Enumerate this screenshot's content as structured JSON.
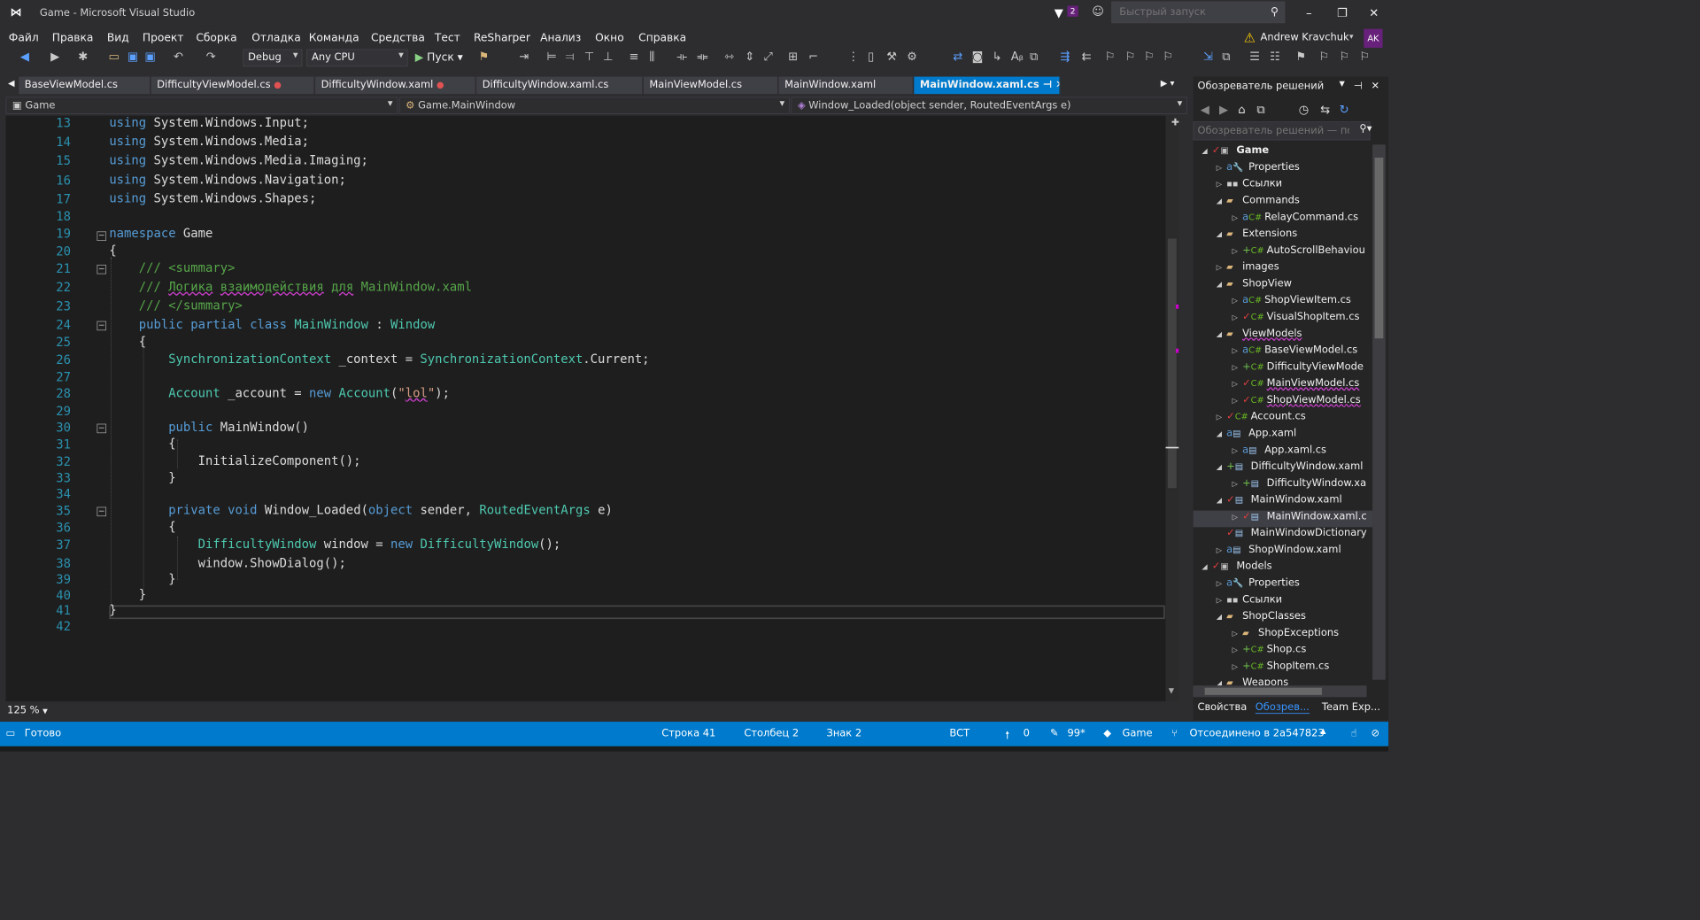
{
  "window": {
    "title": "Game - Microsoft Visual Studio",
    "notifications": "2",
    "quick_launch_placeholder": "Быстрый запуск"
  },
  "menu": [
    "Файл",
    "Правка",
    "Вид",
    "Проект",
    "Сборка",
    "Отладка",
    "Команда",
    "Средства",
    "Тест",
    "ReSharper",
    "Анализ",
    "Окно",
    "Справка"
  ],
  "user": {
    "name": "Andrew Kravchuk",
    "initials": "AK"
  },
  "toolbar": {
    "config": "Debug",
    "platform": "Any CPU",
    "run": "Пуск"
  },
  "tabs": [
    {
      "label": "BaseViewModel.cs",
      "dirty": false
    },
    {
      "label": "DifficultyViewModel.cs",
      "dirty": true
    },
    {
      "label": "DifficultyWindow.xaml",
      "dirty": true
    },
    {
      "label": "DifficultyWindow.xaml.cs",
      "dirty": false
    },
    {
      "label": "MainViewModel.cs",
      "dirty": false
    },
    {
      "label": "MainWindow.xaml",
      "dirty": false
    },
    {
      "label": "MainWindow.xaml.cs",
      "dirty": false,
      "active": true
    }
  ],
  "navbar": {
    "project": "Game",
    "class": "Game.MainWindow",
    "member": "Window_Loaded(object sender, RoutedEventArgs e)"
  },
  "editor": {
    "line_numbers": [
      "13",
      "14",
      "15",
      "16",
      "17",
      "18",
      "19",
      "20",
      "21",
      "22",
      "23",
      "24",
      "25",
      "26",
      "27",
      "28",
      "29",
      "30",
      "31",
      "32",
      "33",
      "34",
      "35",
      "36",
      "37",
      "38",
      "39",
      "40",
      "41",
      "42"
    ],
    "zoom": "125 %"
  },
  "solution_explorer": {
    "title": "Обозреватель решений",
    "search_placeholder": "Обозреватель решений — пои",
    "items": [
      "Game",
      "Properties",
      "Ссылки",
      "Commands",
      "RelayCommand.cs",
      "Extensions",
      "AutoScrollBehaviou",
      "images",
      "ShopView",
      "ShopViewItem.cs",
      "VisualShopItem.cs",
      "ViewModels",
      "BaseViewModel.cs",
      "DifficultyViewMode",
      "MainViewModel.cs",
      "ShopViewModel.cs",
      "Account.cs",
      "App.xaml",
      "App.xaml.cs",
      "DifficultyWindow.xaml",
      "DifficultyWindow.xa",
      "MainWindow.xaml",
      "MainWindow.xaml.c",
      "MainWindowDictionary",
      "ShopWindow.xaml",
      "Models",
      "Properties",
      "Ссылки",
      "ShopClasses",
      "ShopExceptions",
      "Shop.cs",
      "ShopItem.cs",
      "Weapons"
    ],
    "bottom_tabs": [
      "Свойства",
      "Обозрев...",
      "Team Exp..."
    ]
  },
  "status": {
    "ready": "Готово",
    "line": "Строка 41",
    "col": "Столбец 2",
    "char": "Знак 2",
    "mode": "ВСТ",
    "up": "0",
    "edits": "99*",
    "repo": "Game",
    "branch": "Отсоединено в 2a547823"
  }
}
